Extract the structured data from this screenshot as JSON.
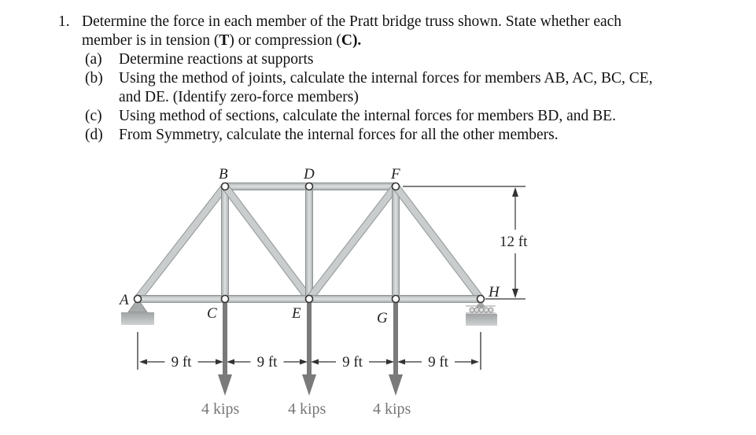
{
  "problem": {
    "number": "1.",
    "line1": "Determine the force in each member of the Pratt bridge truss shown. State whether each",
    "line2_pre": "member is in tension (",
    "tension_symbol": "T",
    "line2_mid": ") or compression (",
    "compression_symbol": "C",
    "line2_post": ").",
    "parts": [
      {
        "marker": "(a)",
        "text": "Determine reactions at supports"
      },
      {
        "marker": "(b)",
        "text": "Using the method of joints, calculate the internal forces for members AB, AC, BC, CE,",
        "text2": "and DE. (Identify zero-force members)"
      },
      {
        "marker": "(c)",
        "text": "Using method of sections, calculate the internal forces for members BD, and BE."
      },
      {
        "marker": "(d)",
        "text": "From Symmetry, calculate the internal forces for all the other members."
      }
    ]
  },
  "truss": {
    "type": "Pratt bridge truss",
    "joints": {
      "A": "A",
      "B": "B",
      "C": "C",
      "D": "D",
      "E": "E",
      "F": "F",
      "G": "G",
      "H": "H"
    },
    "members": [
      "AB",
      "AC",
      "BC",
      "BD",
      "BE",
      "CE",
      "DE",
      "DF",
      "EF",
      "EG",
      "FG",
      "FH",
      "GH"
    ],
    "height_label": "12 ft",
    "spans": [
      "9 ft",
      "9 ft",
      "9 ft",
      "9 ft"
    ],
    "loads": [
      {
        "at": "C",
        "label": "4 kips"
      },
      {
        "at": "E",
        "label": "4 kips"
      },
      {
        "at": "G",
        "label": "4 kips"
      }
    ],
    "supports": {
      "A": "pin",
      "H": "roller"
    },
    "colors": {
      "member_fill": "#c9cdcd",
      "member_edge": "#8e9494",
      "load_arrow": "#7a7a7a",
      "ground": "#b3b3b3"
    }
  }
}
